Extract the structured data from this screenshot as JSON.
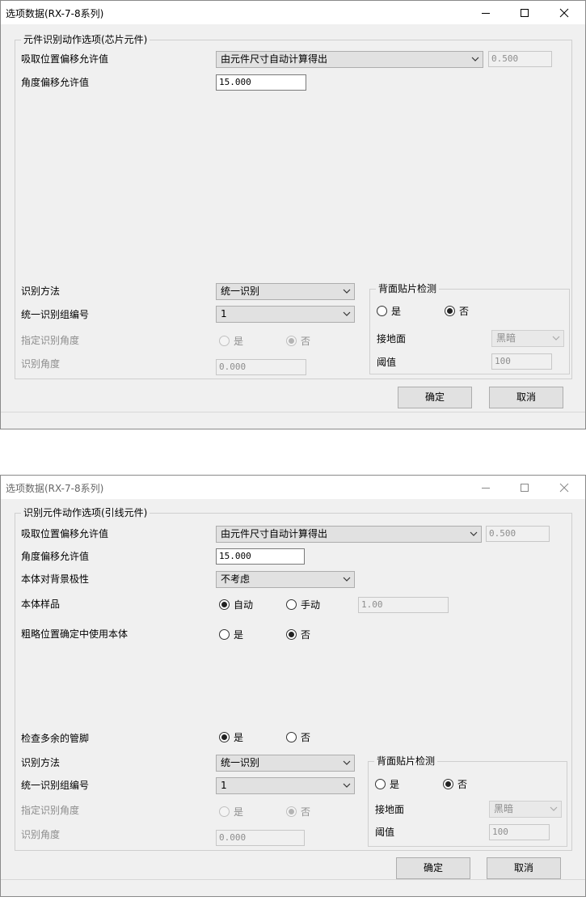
{
  "controls": {
    "minimize_icon": "minimize-icon",
    "maximize_icon": "maximize-icon",
    "close_icon": "close-icon"
  },
  "dialog1": {
    "title": "选项数据(RX-7-8系列)",
    "group_title": "元件识别动作选项(芯片元件)",
    "pickup_offset": {
      "label": "吸取位置偏移允许值",
      "combo": "由元件尺寸自动计算得出",
      "value": "0.500"
    },
    "angle_offset": {
      "label": "角度偏移允许值",
      "value": "15.000"
    },
    "recognition_method": {
      "label": "识别方法",
      "value": "统一识别"
    },
    "group_number": {
      "label": "统一识别组编号",
      "value": "1"
    },
    "specify_angle": {
      "label": "指定识别角度",
      "yes": "是",
      "no": "否",
      "selected": "no"
    },
    "recognition_angle": {
      "label": "识别角度",
      "value": "0.000"
    },
    "back_detection": {
      "title": "背面贴片检测",
      "yes": "是",
      "no": "否",
      "selected": "no",
      "ground_label": "接地面",
      "ground_value": "黑暗",
      "threshold_label": "阈值",
      "threshold_value": "100"
    },
    "ok": "确定",
    "cancel": "取消"
  },
  "dialog2": {
    "title": "选项数据(RX-7-8系列)",
    "group_title": "识别元件动作选项(引线元件)",
    "pickup_offset": {
      "label": "吸取位置偏移允许值",
      "combo": "由元件尺寸自动计算得出",
      "value": "0.500"
    },
    "angle_offset": {
      "label": "角度偏移允许值",
      "value": "15.000"
    },
    "body_polarity": {
      "label": "本体对背景极性",
      "value": "不考虑"
    },
    "body_sample": {
      "label": "本体样品",
      "auto": "自动",
      "manual": "手动",
      "selected": "auto",
      "value": "1.00"
    },
    "rough_position": {
      "label": "粗略位置确定中使用本体",
      "yes": "是",
      "no": "否",
      "selected": "no"
    },
    "extra_pins": {
      "label": "检查多余的管脚",
      "yes": "是",
      "no": "否",
      "selected": "yes"
    },
    "recognition_method": {
      "label": "识别方法",
      "value": "统一识别"
    },
    "group_number": {
      "label": "统一识别组编号",
      "value": "1"
    },
    "specify_angle": {
      "label": "指定识别角度",
      "yes": "是",
      "no": "否",
      "selected": "no"
    },
    "recognition_angle": {
      "label": "识别角度",
      "value": "0.000"
    },
    "back_detection": {
      "title": "背面贴片检测",
      "yes": "是",
      "no": "否",
      "selected": "no",
      "ground_label": "接地面",
      "ground_value": "黑暗",
      "threshold_label": "阈值",
      "threshold_value": "100"
    },
    "ok": "确定",
    "cancel": "取消"
  }
}
